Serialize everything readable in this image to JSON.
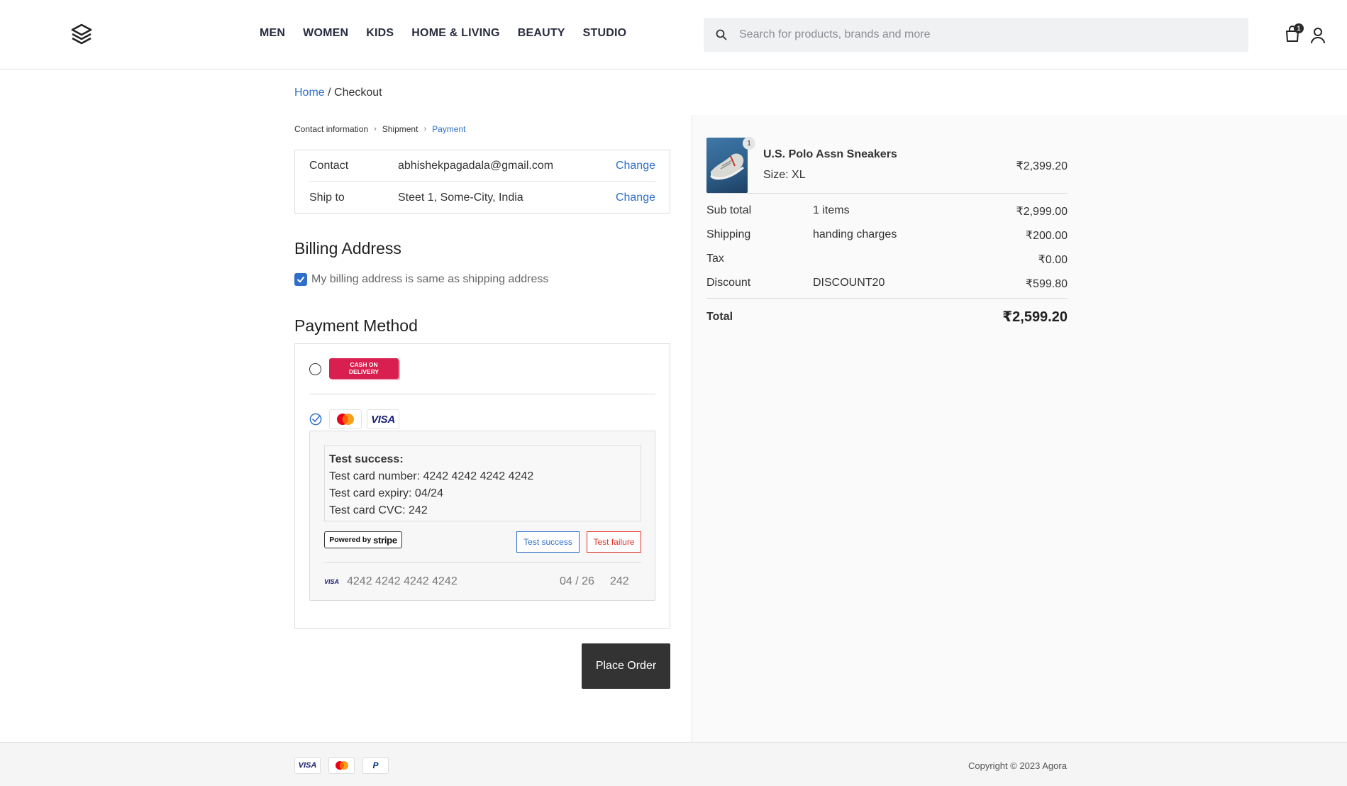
{
  "header": {
    "nav": [
      "MEN",
      "WOMEN",
      "KIDS",
      "HOME & LIVING",
      "BEAUTY",
      "STUDIO"
    ],
    "search_placeholder": "Search for products, brands and more",
    "cart_count": "1"
  },
  "breadcrumb": {
    "home": "Home",
    "separator": " / ",
    "current": "Checkout"
  },
  "steps": {
    "contact": "Contact information",
    "shipment": "Shipment",
    "payment": "Payment"
  },
  "info": {
    "contact_label": "Contact",
    "contact_value": "abhishekpagadala@gmail.com",
    "ship_label": "Ship to",
    "ship_value": "Steet 1, Some-City, India",
    "change": "Change"
  },
  "billing": {
    "title": "Billing Address",
    "same_label": "My billing address is same as shipping address",
    "same_checked": true
  },
  "payment": {
    "title": "Payment Method",
    "cod_line1": "CASH ON",
    "cod_line2": "DELIVERY",
    "mastercard_icon": "mastercard-icon",
    "visa_label": "VISA",
    "test_title": "Test success:",
    "test_card_number": "Test card number: 4242 4242 4242 4242",
    "test_card_expiry": "Test card expiry: 04/24",
    "test_card_cvc": "Test card CVC: 242",
    "powered_by": "Powered by",
    "stripe": "stripe",
    "test_success_btn": "Test success",
    "test_failure_btn": "Test failure",
    "visa_mini": "VISA",
    "card_number": "4242 4242 4242 4242",
    "card_expiry": "04 / 26",
    "card_cvc": "242",
    "place_order": "Place Order"
  },
  "summary": {
    "qty": "1",
    "product_name": "U.S. Polo Assn Sneakers",
    "product_size": "Size: XL",
    "product_price": "₹2,399.20",
    "rows": [
      {
        "key": "Sub total",
        "mid": "1 items",
        "value": "₹2,999.00"
      },
      {
        "key": "Shipping",
        "mid": "handing charges",
        "value": "₹200.00"
      },
      {
        "key": "Tax",
        "mid": "",
        "value": "₹0.00"
      },
      {
        "key": "Discount",
        "mid": "DISCOUNT20",
        "value": "₹599.80"
      }
    ],
    "total_label": "Total",
    "total_value": "₹2,599.20"
  },
  "footer": {
    "visa": "VISA",
    "paypal": "P",
    "copyright": "Copyright © 2023 Agora"
  },
  "colors": {
    "accent": "#2f6fca",
    "cod": "#d81f50",
    "danger": "#e0352b",
    "button_dark": "#333333"
  }
}
